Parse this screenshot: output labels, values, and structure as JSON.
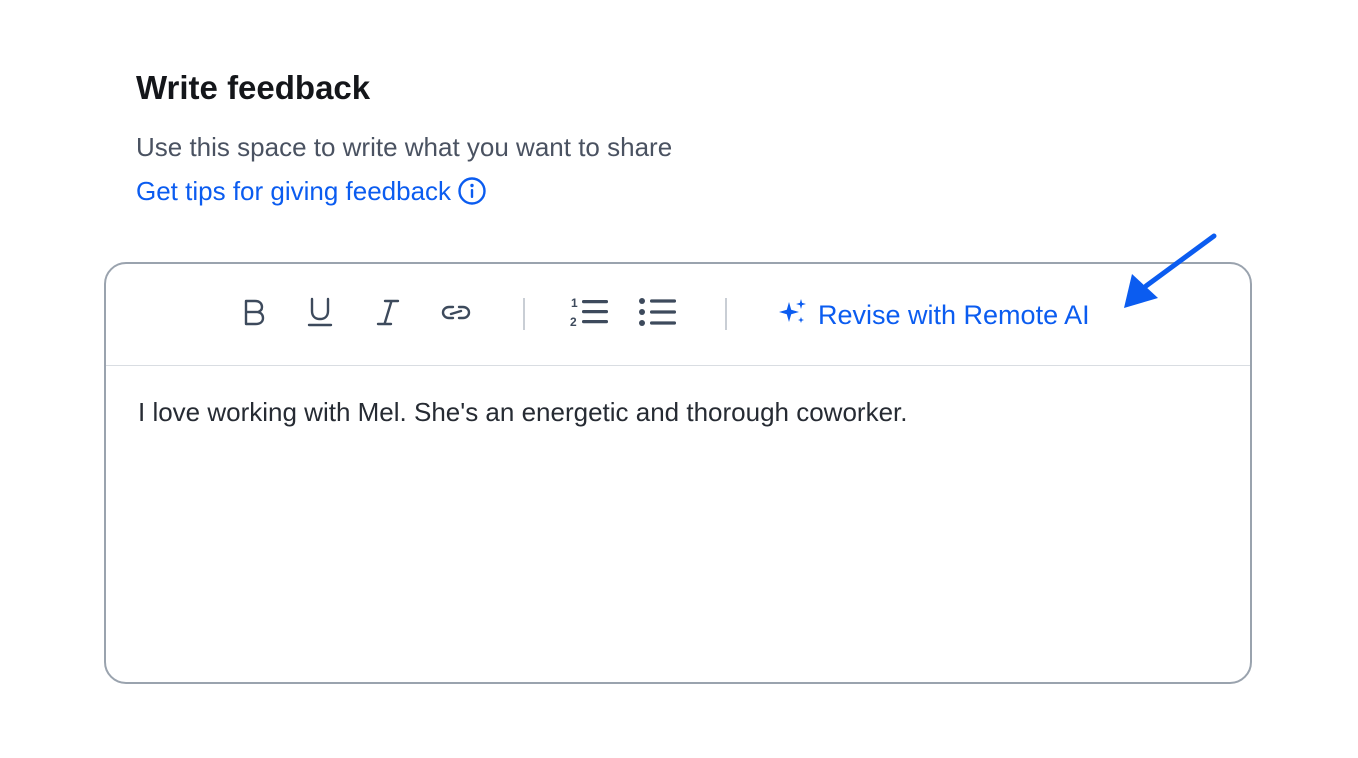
{
  "heading": {
    "title": "Write feedback",
    "subtitle": "Use this space to write what you want to share",
    "tips_link": "Get tips for giving feedback"
  },
  "toolbar": {
    "revise_label": "Revise with Remote AI",
    "tools": [
      "bold-icon",
      "underline-icon",
      "italic-icon",
      "link-icon",
      "numbered-list-icon",
      "bullet-list-icon",
      "sparkle-icon",
      "info-icon"
    ]
  },
  "editor": {
    "content": "I love working with Mel. She's an energetic and thorough coworker."
  },
  "colors": {
    "accent": "#0b5cf0",
    "text": "#14161a",
    "muted": "#4a5261",
    "border": "#9aa3ae",
    "icon": "#3d4a5c"
  }
}
